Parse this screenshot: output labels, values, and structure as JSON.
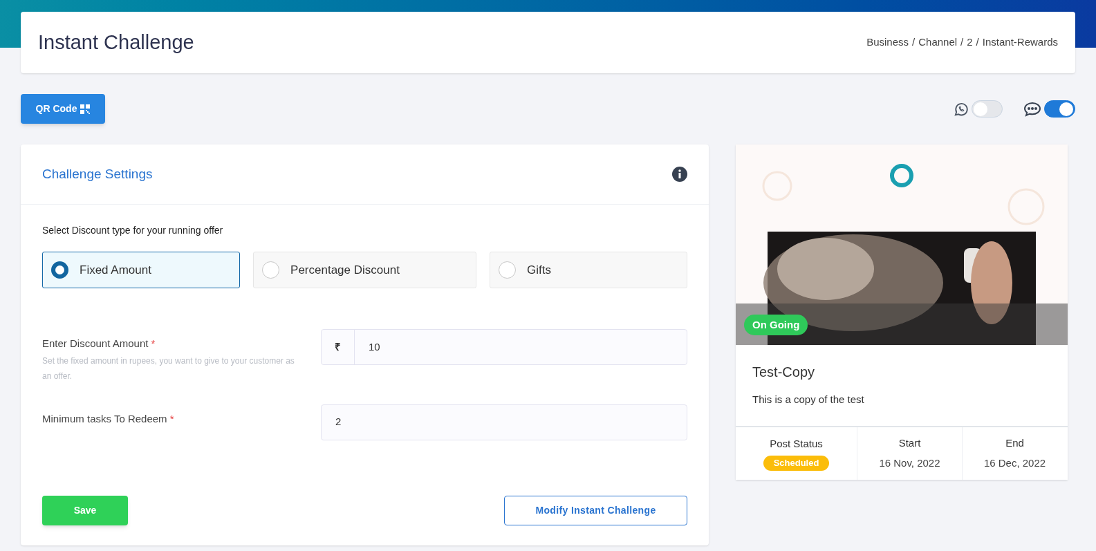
{
  "header": {
    "title": "Instant Challenge",
    "breadcrumb": [
      "Business",
      "Channel",
      "2",
      "Instant-Rewards"
    ],
    "separator": "/"
  },
  "qr_button": {
    "label": "QR Code"
  },
  "toggles": [
    {
      "kind": "whatsapp",
      "on": false
    },
    {
      "kind": "chat",
      "on": true
    }
  ],
  "settings": {
    "title": "Challenge Settings",
    "prompt": "Select Discount type for your running offer",
    "options": [
      {
        "label": "Fixed Amount",
        "selected": true
      },
      {
        "label": "Percentage Discount",
        "selected": false
      },
      {
        "label": "Gifts",
        "selected": false
      }
    ],
    "fields": [
      {
        "label": "Enter Discount Amount",
        "required_mark": "*",
        "help": "Set the fixed amount in rupees, you want to give to your customer as an offer.",
        "prefix": "₹",
        "value": "10"
      },
      {
        "label": "Minimum tasks To Redeem",
        "required_mark": "*",
        "value": "2"
      }
    ],
    "save_button": "Save",
    "modify_button": "Modify Instant Challenge"
  },
  "challenge_card": {
    "badge": "On Going",
    "title": "Test-Copy",
    "description": "This is a copy of the test",
    "stats": [
      {
        "label": "Post Status",
        "value": "Scheduled",
        "kind": "badge"
      },
      {
        "label": "Start",
        "value": "16 Nov, 2022",
        "kind": "text"
      },
      {
        "label": "End",
        "value": "16 Dec, 2022",
        "kind": "text"
      }
    ]
  }
}
